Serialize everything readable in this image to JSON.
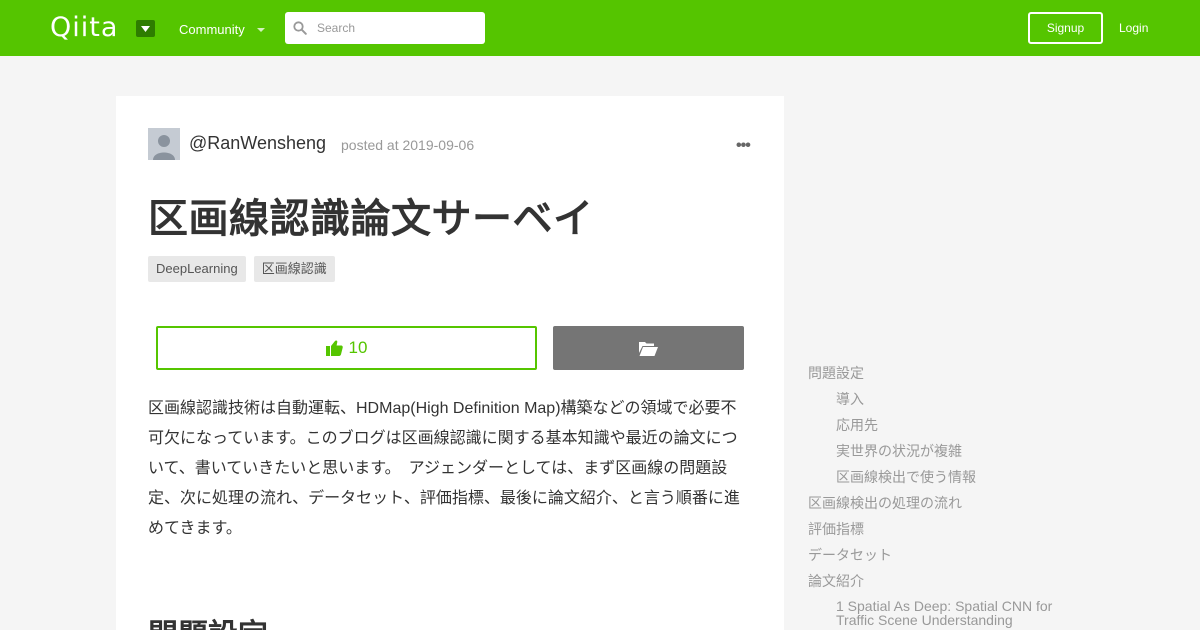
{
  "header": {
    "logo": "Qiita",
    "community_label": "Community",
    "search_placeholder": "Search",
    "signup_label": "Signup",
    "login_label": "Login",
    "brand_color": "#55c500"
  },
  "article": {
    "username": "@RanWensheng",
    "posted": "posted at 2019-09-06",
    "more_icon": "•••",
    "title": "区画線認識論文サーベイ",
    "tags": [
      "DeepLearning",
      "区画線認識"
    ],
    "like_count": "10",
    "body": "区画線認識技術は自動運転、HDMap(High Definition Map)構築などの領域で必要不可欠になっています。このブログは区画線認識に関する基本知識や最近の論文について、書いていきたいと思います。　アジェンダーとしては、まず区画線の問題設定、次に処理の流れ、データセット、評価指標、最後に論文紹介、と言う順番に進めてきます。",
    "section_heading": "問題設定"
  },
  "toc": [
    {
      "label": "問題設定",
      "level": 1
    },
    {
      "label": "導入",
      "level": 2
    },
    {
      "label": "応用先",
      "level": 2
    },
    {
      "label": "実世界の状況が複雑",
      "level": 2
    },
    {
      "label": "区画線検出で使う情報",
      "level": 2
    },
    {
      "label": "区画線検出の処理の流れ",
      "level": 1
    },
    {
      "label": "評価指標",
      "level": 1
    },
    {
      "label": "データセット",
      "level": 1
    },
    {
      "label": "論文紹介",
      "level": 1
    },
    {
      "label": "1 Spatial As Deep: Spatial CNN for Traffic Scene Understanding",
      "level": 2
    }
  ]
}
